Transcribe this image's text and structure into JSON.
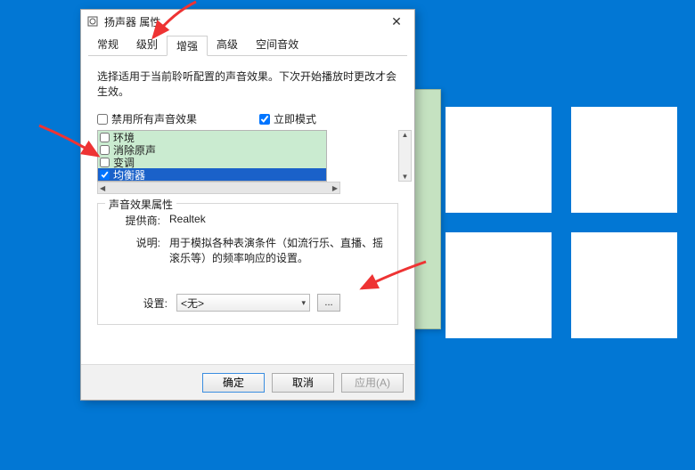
{
  "window": {
    "title": "扬声器 属性"
  },
  "tabs": {
    "general": "常规",
    "levels": "级别",
    "enhance": "增强",
    "advanced": "高级",
    "spatial": "空间音效"
  },
  "content": {
    "description": "选择适用于当前聆听配置的声音效果。下次开始播放时更改才会生效。",
    "disable_all": "禁用所有声音效果",
    "immediate": "立即模式",
    "effects": [
      {
        "label": "环境",
        "checked": false
      },
      {
        "label": "消除原声",
        "checked": false
      },
      {
        "label": "变调",
        "checked": false
      },
      {
        "label": "均衡器",
        "checked": true,
        "selected": true
      }
    ],
    "props_legend": "声音效果属性",
    "provider_label": "提供商:",
    "provider_value": "Realtek",
    "desc_label": "说明:",
    "desc_value": "用于模拟各种表演条件（如流行乐、直播、摇滚乐等）的频率响应的设置。",
    "setting_label": "设置:",
    "setting_value": "<无>",
    "ellipsis": "..."
  },
  "footer": {
    "ok": "确定",
    "cancel": "取消",
    "apply": "应用(A)"
  }
}
